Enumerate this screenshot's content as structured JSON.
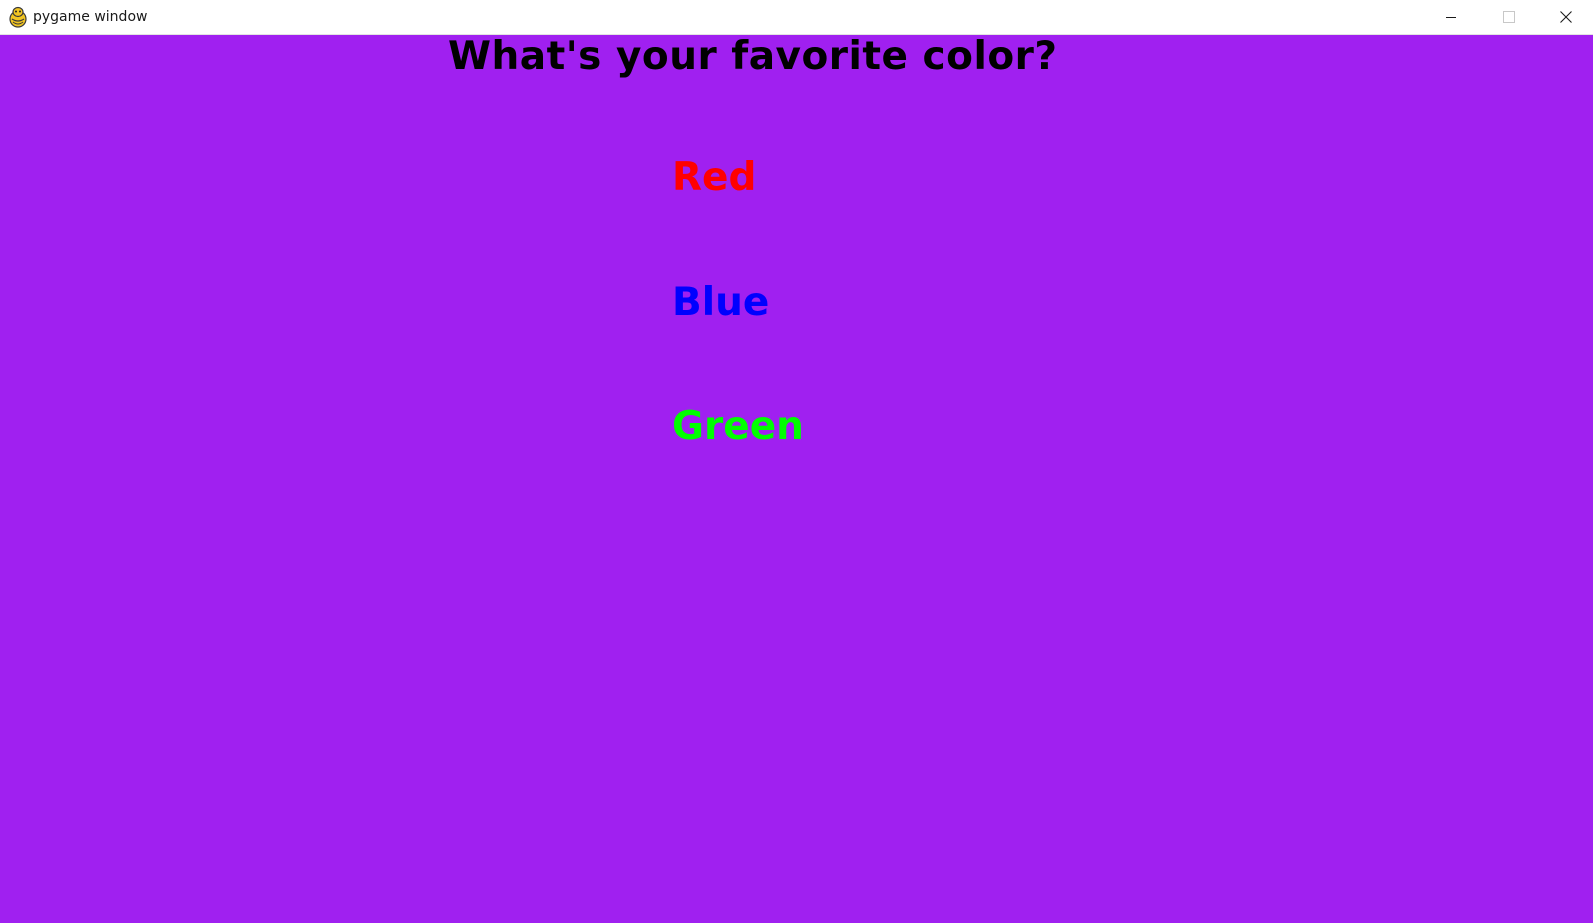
{
  "window": {
    "title": "pygame window",
    "app_icon": "pygame-snake-icon",
    "controls": [
      "minimize-icon",
      "maximize-icon",
      "close-icon"
    ]
  },
  "game": {
    "background_color": "#a020f0",
    "question": "What's your favorite color?",
    "question_color": "#000000",
    "options": [
      {
        "label": "Red",
        "color": "#ff0000"
      },
      {
        "label": "Blue",
        "color": "#0000ff"
      },
      {
        "label": "Green",
        "color": "#00ff00"
      }
    ]
  }
}
